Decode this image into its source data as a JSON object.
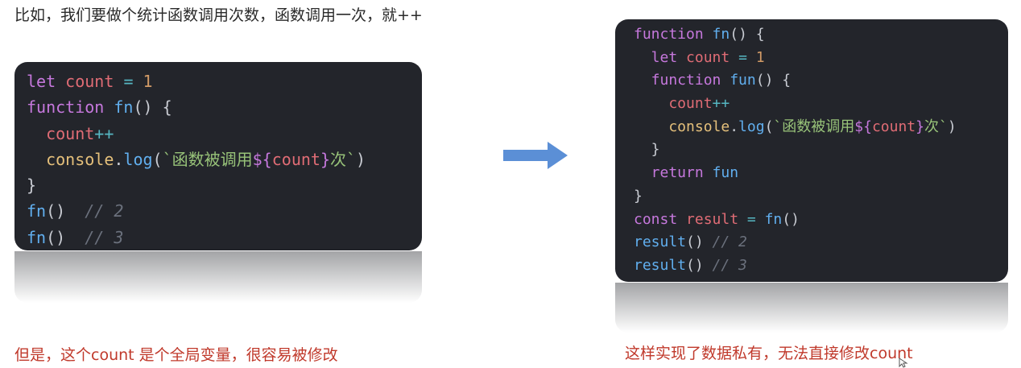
{
  "slide": {
    "heading": "比如，我们要做个统计函数调用次数，函数调用一次，就++",
    "left_caption": "但是，这个count 是个全局变量，很容易被修改",
    "right_caption": "这样实现了数据私有，无法直接修改count"
  },
  "left_code": [
    {
      "indent": 0,
      "tokens": [
        {
          "c": "kw",
          "t": "let"
        },
        {
          "c": "punc",
          "t": " "
        },
        {
          "c": "var",
          "t": "count"
        },
        {
          "c": "punc",
          "t": " "
        },
        {
          "c": "op",
          "t": "="
        },
        {
          "c": "punc",
          "t": " "
        },
        {
          "c": "num",
          "t": "1"
        }
      ]
    },
    {
      "indent": 0,
      "tokens": [
        {
          "c": "kw",
          "t": "function"
        },
        {
          "c": "punc",
          "t": " "
        },
        {
          "c": "fn",
          "t": "fn"
        },
        {
          "c": "punc",
          "t": "() {"
        }
      ]
    },
    {
      "indent": 1,
      "tokens": [
        {
          "c": "var",
          "t": "count"
        },
        {
          "c": "op",
          "t": "++"
        }
      ]
    },
    {
      "indent": 1,
      "tokens": [
        {
          "c": "obj",
          "t": "console"
        },
        {
          "c": "punc",
          "t": "."
        },
        {
          "c": "fn",
          "t": "log"
        },
        {
          "c": "punc",
          "t": "("
        },
        {
          "c": "str",
          "t": "`函数被调用"
        },
        {
          "c": "tpl",
          "t": "${"
        },
        {
          "c": "var",
          "t": "count"
        },
        {
          "c": "tpl",
          "t": "}"
        },
        {
          "c": "str",
          "t": "次`"
        },
        {
          "c": "punc",
          "t": ")"
        }
      ]
    },
    {
      "indent": 0,
      "tokens": [
        {
          "c": "punc",
          "t": "}"
        }
      ]
    },
    {
      "indent": 0,
      "tokens": [
        {
          "c": "fn",
          "t": "fn"
        },
        {
          "c": "punc",
          "t": "()  "
        },
        {
          "c": "cm",
          "t": "// 2"
        }
      ]
    },
    {
      "indent": 0,
      "tokens": [
        {
          "c": "fn",
          "t": "fn"
        },
        {
          "c": "punc",
          "t": "()  "
        },
        {
          "c": "cm",
          "t": "// 3"
        }
      ]
    }
  ],
  "right_code": [
    {
      "indent": 0,
      "tokens": [
        {
          "c": "kw",
          "t": "function"
        },
        {
          "c": "punc",
          "t": " "
        },
        {
          "c": "fn",
          "t": "fn"
        },
        {
          "c": "punc",
          "t": "() {"
        }
      ]
    },
    {
      "indent": 1,
      "tokens": [
        {
          "c": "kw",
          "t": "let"
        },
        {
          "c": "punc",
          "t": " "
        },
        {
          "c": "var",
          "t": "count"
        },
        {
          "c": "punc",
          "t": " "
        },
        {
          "c": "op",
          "t": "="
        },
        {
          "c": "punc",
          "t": " "
        },
        {
          "c": "num",
          "t": "1"
        }
      ]
    },
    {
      "indent": 1,
      "tokens": [
        {
          "c": "kw",
          "t": "function"
        },
        {
          "c": "punc",
          "t": " "
        },
        {
          "c": "fn",
          "t": "fun"
        },
        {
          "c": "punc",
          "t": "() {"
        }
      ]
    },
    {
      "indent": 2,
      "tokens": [
        {
          "c": "var",
          "t": "count"
        },
        {
          "c": "op",
          "t": "++"
        }
      ]
    },
    {
      "indent": 2,
      "tokens": [
        {
          "c": "obj",
          "t": "console"
        },
        {
          "c": "punc",
          "t": "."
        },
        {
          "c": "fn",
          "t": "log"
        },
        {
          "c": "punc",
          "t": "("
        },
        {
          "c": "str",
          "t": "`函数被调用"
        },
        {
          "c": "tpl",
          "t": "${"
        },
        {
          "c": "var",
          "t": "count"
        },
        {
          "c": "tpl",
          "t": "}"
        },
        {
          "c": "str",
          "t": "次`"
        },
        {
          "c": "punc",
          "t": ")"
        }
      ]
    },
    {
      "indent": 1,
      "tokens": [
        {
          "c": "punc",
          "t": "}"
        }
      ]
    },
    {
      "indent": 1,
      "tokens": [
        {
          "c": "kw",
          "t": "return"
        },
        {
          "c": "punc",
          "t": " "
        },
        {
          "c": "fn",
          "t": "fun"
        }
      ]
    },
    {
      "indent": 0,
      "tokens": [
        {
          "c": "punc",
          "t": "}"
        }
      ]
    },
    {
      "indent": 0,
      "tokens": [
        {
          "c": "kw",
          "t": "const"
        },
        {
          "c": "punc",
          "t": " "
        },
        {
          "c": "var",
          "t": "result"
        },
        {
          "c": "punc",
          "t": " "
        },
        {
          "c": "op",
          "t": "="
        },
        {
          "c": "punc",
          "t": " "
        },
        {
          "c": "fn",
          "t": "fn"
        },
        {
          "c": "punc",
          "t": "()"
        }
      ]
    },
    {
      "indent": 0,
      "tokens": [
        {
          "c": "fn",
          "t": "result"
        },
        {
          "c": "punc",
          "t": "() "
        },
        {
          "c": "cm",
          "t": "// 2"
        }
      ]
    },
    {
      "indent": 0,
      "tokens": [
        {
          "c": "fn",
          "t": "result"
        },
        {
          "c": "punc",
          "t": "() "
        },
        {
          "c": "cm",
          "t": "// 3"
        }
      ]
    }
  ],
  "icons": {
    "arrow": "right-arrow-icon",
    "cursor": "mouse-pointer-icon"
  },
  "colors": {
    "arrow_fill": "#5b8fd6",
    "caption_color": "#c0392b",
    "panel_bg": "#23252b"
  }
}
